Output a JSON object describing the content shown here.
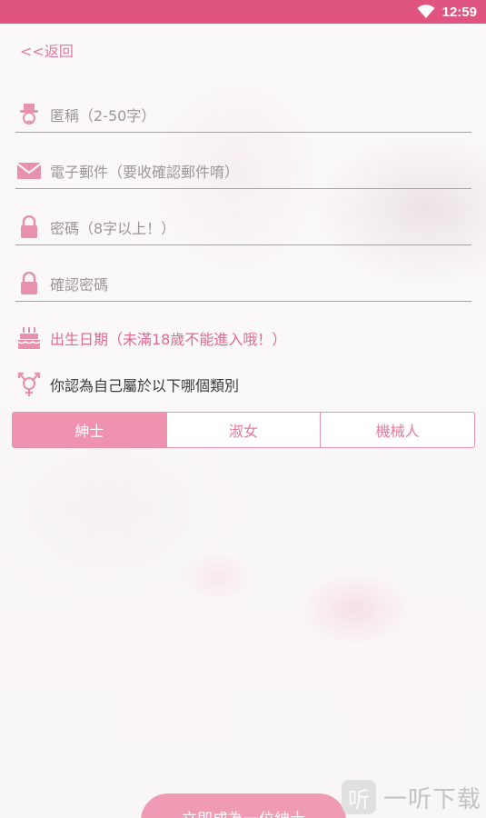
{
  "status_bar": {
    "time": "12:59",
    "wifi_icon": "wifi-icon"
  },
  "header": {
    "back_label": "<<返回"
  },
  "form": {
    "nickname": {
      "placeholder": "匿稱（2-50字）",
      "icon": "gentleman-icon"
    },
    "email": {
      "placeholder": "電子郵件（要收確認郵件唷）",
      "icon": "envelope-icon"
    },
    "password": {
      "placeholder": "密碼（8字以上！）",
      "icon": "lock-icon"
    },
    "confirm_password": {
      "placeholder": "確認密碼",
      "icon": "lock-icon"
    },
    "birthday": {
      "label": "出生日期（未滿18歲不能進入哦！）",
      "icon": "cake-icon"
    },
    "gender_question": {
      "label": "你認為自己屬於以下哪個類別",
      "icon": "gender-icon"
    },
    "gender_options": [
      {
        "label": "紳士",
        "selected": true
      },
      {
        "label": "淑女",
        "selected": false
      },
      {
        "label": "機械人",
        "selected": false
      }
    ],
    "submit_label": "立即成為一位紳士"
  },
  "watermark": {
    "text": "一听下载",
    "mark": "听"
  },
  "colors": {
    "status_bar": "#e0557f",
    "accent": "#e27b9c",
    "segment_active": "#ee92af",
    "submit": "#ef9bb4"
  }
}
